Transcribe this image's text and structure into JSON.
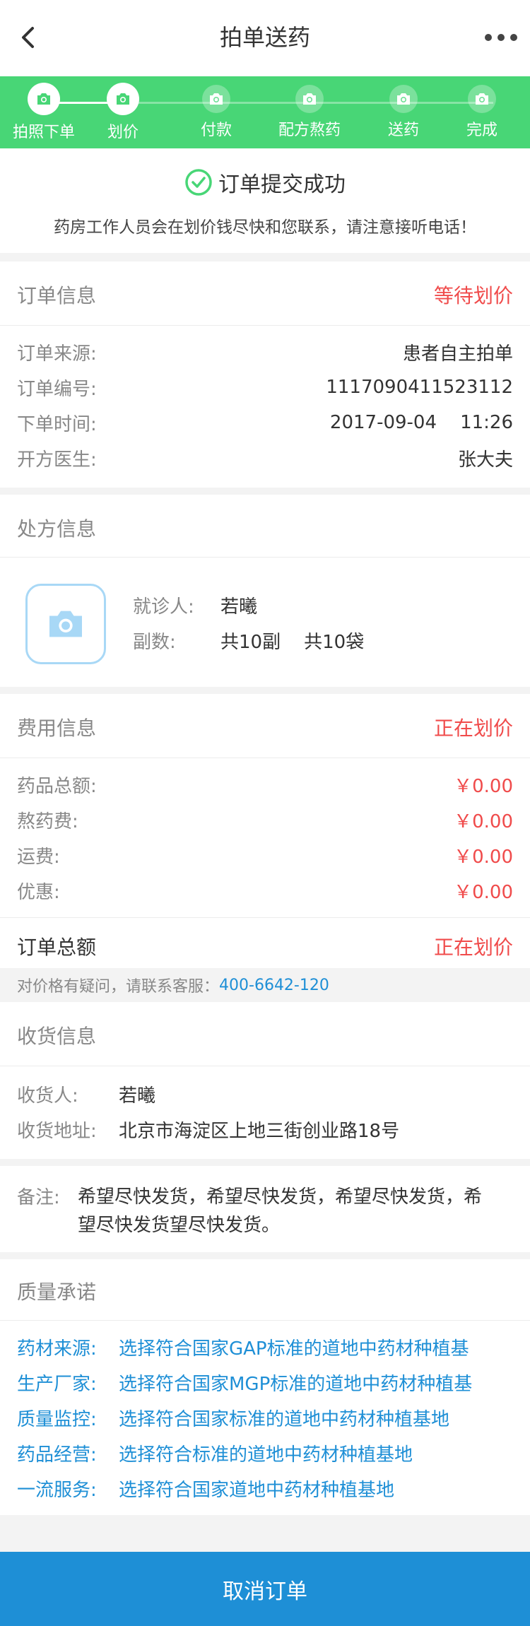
{
  "nav": {
    "title": "拍单送药"
  },
  "steps": [
    {
      "label": "拍照下单",
      "state": "done"
    },
    {
      "label": "划价",
      "state": "done"
    },
    {
      "label": "付款",
      "state": "pending"
    },
    {
      "label": "配方熬药",
      "state": "pending"
    },
    {
      "label": "送药",
      "state": "pending"
    },
    {
      "label": "完成",
      "state": "pending"
    }
  ],
  "success": {
    "title": "订单提交成功",
    "message": "药房工作人员会在划价钱尽快和您联系，请注意接听电话！"
  },
  "order": {
    "section_title": "订单信息",
    "status": "等待划价",
    "rows": [
      {
        "key": "订单来源:",
        "value": "患者自主拍单"
      },
      {
        "key": "订单编号:",
        "value": "1117090411523112"
      },
      {
        "key": "下单时间:",
        "value": "2017-09-04    11:26"
      },
      {
        "key": "开方医生:",
        "value": "张大夫"
      }
    ]
  },
  "prescription": {
    "section_title": "处方信息",
    "patient_label": "就诊人:",
    "patient_value": "若曦",
    "doses_label": "副数:",
    "doses_value": "共10副    共10袋"
  },
  "fees": {
    "section_title": "费用信息",
    "status": "正在划价",
    "rows": [
      {
        "key": "药品总额:",
        "value": "￥0.00"
      },
      {
        "key": "熬药费:",
        "value": "￥0.00"
      },
      {
        "key": "运费:",
        "value": "￥0.00"
      },
      {
        "key": "优惠:",
        "value": "￥0.00"
      }
    ],
    "total_label": "订单总额",
    "total_value": "正在划价",
    "help_text": "对价格有疑问，请联系客服：",
    "help_phone": "400-6642-120"
  },
  "delivery": {
    "section_title": "收货信息",
    "receiver_label": "收货人:",
    "receiver_value": "若曦",
    "address_label": "收货地址:",
    "address_value": "北京市海淀区上地三街创业路18号"
  },
  "remark": {
    "label": "备注:",
    "line1": "希望尽快发货，希望尽快发货，希望尽快发货，希",
    "line2": "望尽快发货望尽快发货。"
  },
  "quality": {
    "section_title": "质量承诺",
    "rows": [
      {
        "key": "药材来源:",
        "value": "选择符合国家GAP标准的道地中药材种植基"
      },
      {
        "key": "生产厂家:",
        "value": "选择符合国家MGP标准的道地中药材种植基"
      },
      {
        "key": "质量监控:",
        "value": "选择符合国家标准的道地中药材种植基地"
      },
      {
        "key": "药品经营:",
        "value": "选择符合标准的道地中药材种植基地"
      },
      {
        "key": "一流服务:",
        "value": "选择符合国家道地中药材种植基地"
      }
    ]
  },
  "cancel_label": "取消订单",
  "colors": {
    "green": "#48d676",
    "blue": "#1e8fd6",
    "red": "#f04b4b"
  }
}
